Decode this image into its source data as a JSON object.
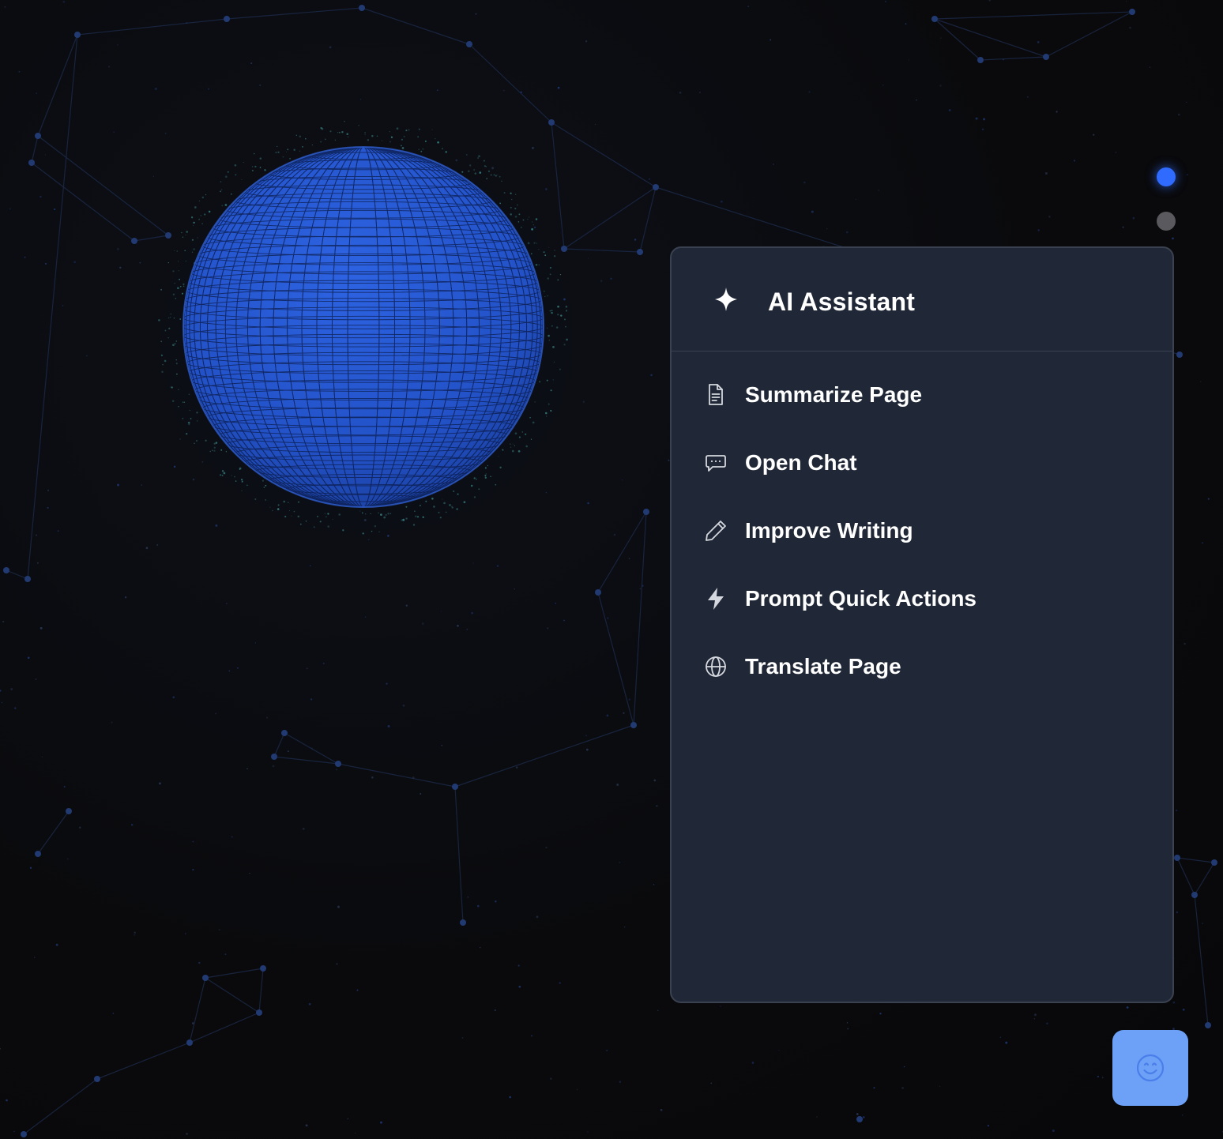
{
  "panel": {
    "title": "AI Assistant",
    "title_icon": "sparkle-icon",
    "menu": [
      {
        "label": "Summarize Page",
        "icon": "document-icon"
      },
      {
        "label": "Open Chat",
        "icon": "chat-bubble-icon"
      },
      {
        "label": "Improve Writing",
        "icon": "pencil-icon"
      },
      {
        "label": "Prompt Quick Actions",
        "icon": "lightning-icon"
      },
      {
        "label": "Translate Page",
        "icon": "globe-icon"
      }
    ]
  },
  "indicators": [
    {
      "state": "active",
      "color": "#2f6bff"
    },
    {
      "state": "inactive",
      "color": "#5a5a5e"
    }
  ],
  "fab": {
    "icon": "smiley-icon",
    "color": "#6da0f7"
  },
  "colors": {
    "background": "#0a0a0c",
    "panel": "#202736",
    "accent": "#2f6bff",
    "globe": "#2a5ed8"
  }
}
